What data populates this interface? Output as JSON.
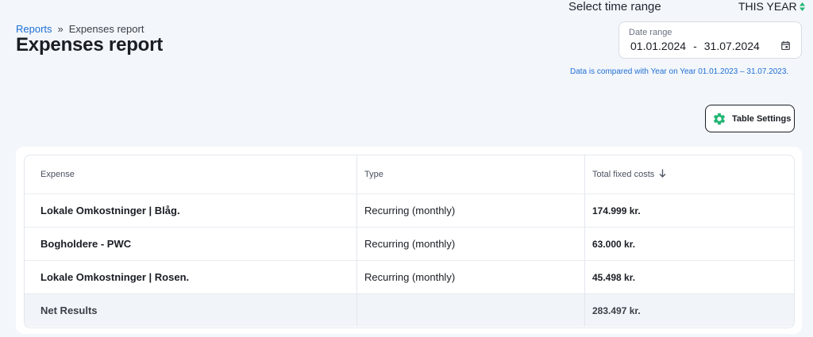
{
  "breadcrumb": {
    "parent": "Reports",
    "separator": "»",
    "current": "Expenses report"
  },
  "page_title": "Expenses report",
  "time_range": {
    "label": "Select time range",
    "selected": "THIS YEAR",
    "arrows_icon": "sort-arrows-icon",
    "arrows_color": "#22b573"
  },
  "date_range": {
    "label": "Date range",
    "start": "01.01.2024",
    "dash": "-",
    "end": "31.07.2024",
    "icon": "calendar-icon"
  },
  "compare_note": "Data is compared with Year on Year 01.01.2023 – 31.07.2023.",
  "table_settings": {
    "label": "Table Settings",
    "icon": "gear-icon",
    "icon_color": "#22b573"
  },
  "table": {
    "columns": [
      "Expense",
      "Type",
      "Total fixed costs"
    ],
    "sort_column": "Total fixed costs",
    "sort_direction": "descending",
    "rows": [
      {
        "expense": "Lokale Omkostninger | Blåg.",
        "type": "Recurring (monthly)",
        "total": "174.999 kr."
      },
      {
        "expense": "Bogholdere - PWC",
        "type": "Recurring (monthly)",
        "total": "63.000 kr."
      },
      {
        "expense": "Lokale Omkostninger | Rosen.",
        "type": "Recurring (monthly)",
        "total": "45.498 kr."
      }
    ],
    "footer": {
      "label": "Net Results",
      "type": "",
      "total": "283.497 kr."
    }
  },
  "colors": {
    "accent_link": "#1f6fd6",
    "accent_green": "#22b573",
    "background": "#f3f6fa"
  }
}
